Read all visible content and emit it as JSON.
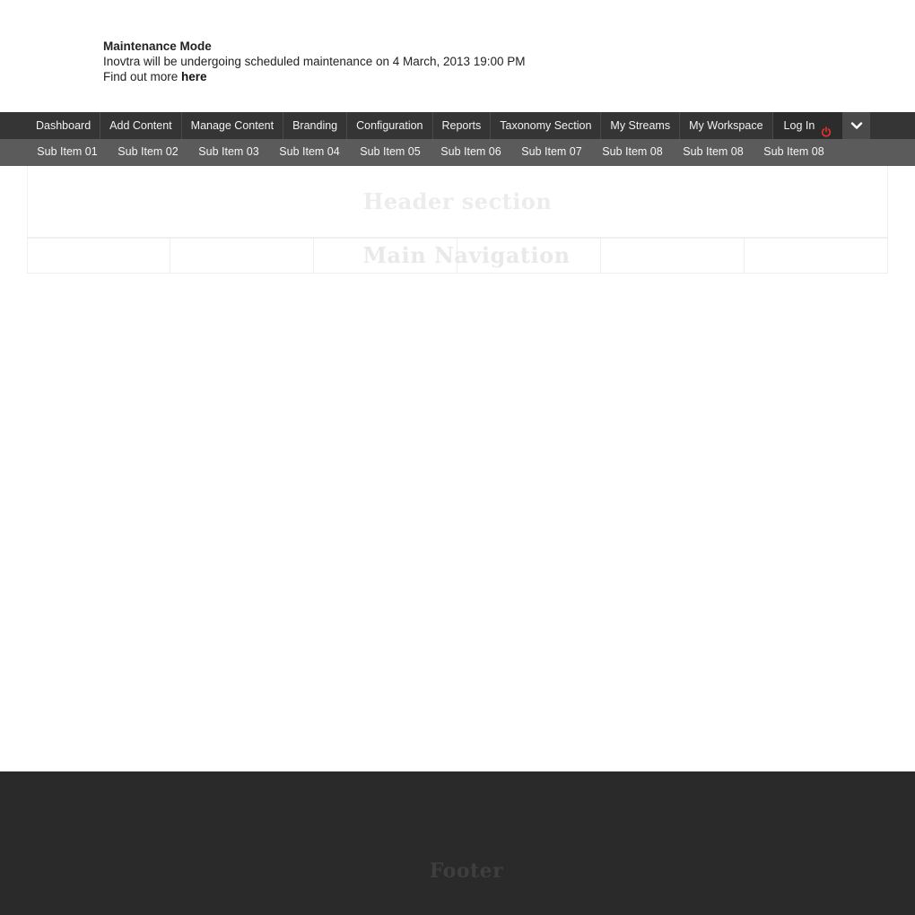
{
  "maintenance": {
    "title": "Maintenance Mode",
    "message": "Inovtra will be undergoing scheduled maintenance on 4 March, 2013 19:00 PM",
    "find_more": "Find out more ",
    "link_label": "here"
  },
  "admin_bar": {
    "items": [
      {
        "label": "Dashboard"
      },
      {
        "label": "Add Content"
      },
      {
        "label": "Manage Content"
      },
      {
        "label": "Branding"
      },
      {
        "label": "Configuration"
      },
      {
        "label": "Reports"
      },
      {
        "label": "Taxonomy Section"
      },
      {
        "label": "My Streams"
      },
      {
        "label": "My Workspace"
      }
    ],
    "login_label": "Log In",
    "login_icon": "power-icon",
    "toggle_icon": "chevron-down-icon",
    "power_color": "#e0342b"
  },
  "sub_bar": {
    "items": [
      {
        "label": "Sub Item 01"
      },
      {
        "label": "Sub Item 02"
      },
      {
        "label": "Sub Item 03"
      },
      {
        "label": "Sub Item 04"
      },
      {
        "label": "Sub Item 05"
      },
      {
        "label": "Sub Item 06"
      },
      {
        "label": "Sub Item 07"
      },
      {
        "label": "Sub Item 08"
      },
      {
        "label": "Sub Item 08"
      },
      {
        "label": "Sub Item 08"
      }
    ]
  },
  "wireframe": {
    "header_label": "Header section",
    "nav_label": "Main Navigation",
    "footer_label": "Footer"
  }
}
